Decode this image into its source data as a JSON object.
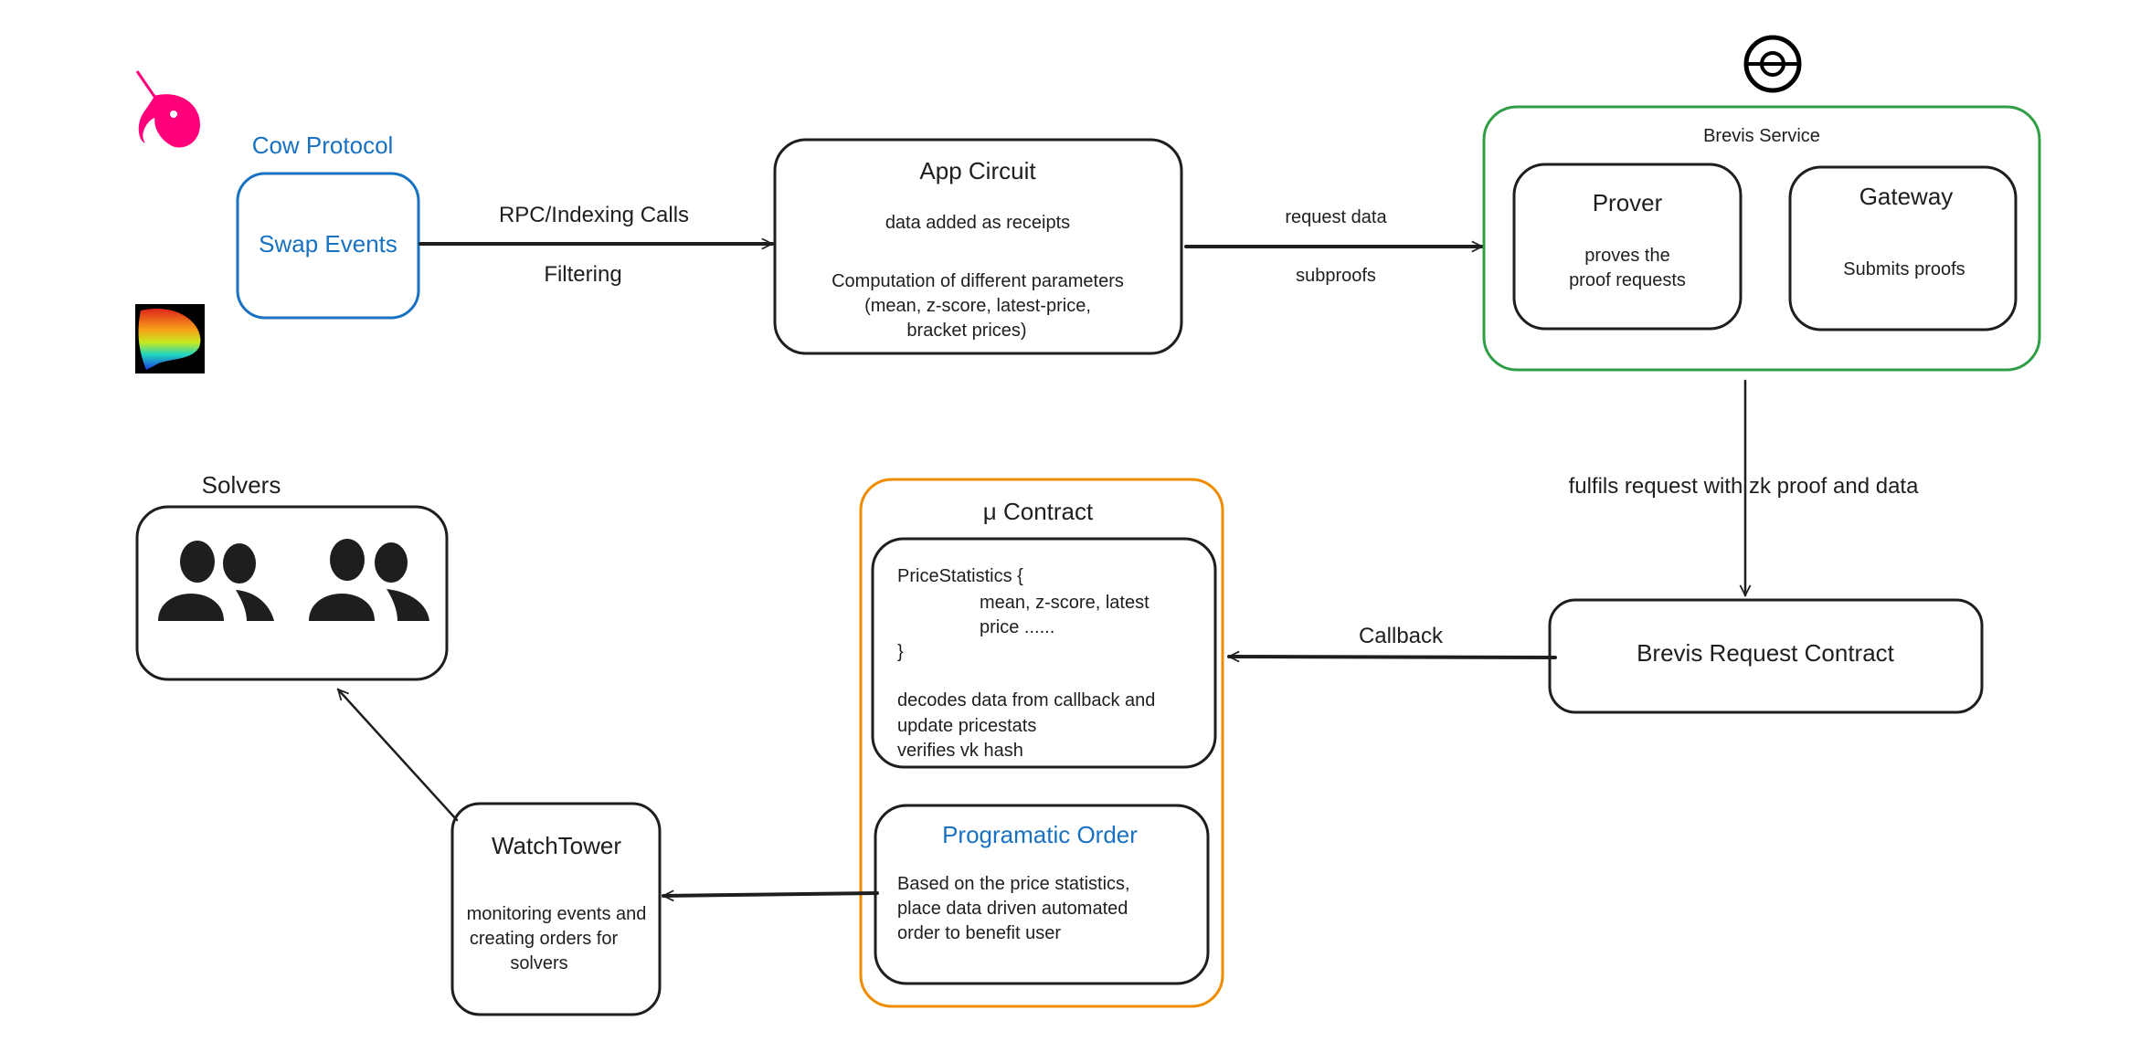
{
  "colors": {
    "ink": "#1e1e1e",
    "blue": "#1971c2",
    "green": "#2f9e44",
    "orange": "#f08c00",
    "uniswap_pink": "#ff007a"
  },
  "logos": {
    "uniswap": "Uniswap unicorn logo",
    "curve": "Curve logo",
    "brevis": "Brevis logo"
  },
  "source": {
    "title": "Cow Protocol",
    "box_label": "Swap Events"
  },
  "edge_source_app": {
    "top": "RPC/Indexing Calls",
    "bottom": "Filtering"
  },
  "app_circuit": {
    "title": "App Circuit",
    "line1": "data added as receipts",
    "line2": "Computation of different parameters",
    "line3": "(mean, z-score, latest-price,",
    "line4": "bracket prices)"
  },
  "edge_app_brevis": {
    "top": "request data",
    "bottom": "subproofs"
  },
  "brevis_service": {
    "title": "Brevis Service",
    "prover": {
      "title": "Prover",
      "line1": "proves the",
      "line2": "proof requests"
    },
    "gateway": {
      "title": "Gateway",
      "line1": "Submits proofs"
    }
  },
  "edge_fulfil": "fulfils request with zk proof and data",
  "brevis_request_contract": "Brevis Request Contract",
  "edge_callback": "Callback",
  "mu_contract": {
    "title": "μ Contract",
    "stats": {
      "line1": "PriceStatistics {",
      "line2": "mean, z-score, latest",
      "line3": "price ......",
      "line4": "}",
      "line5": "decodes data from callback and",
      "line6": "update pricestats",
      "line7": "verifies vk hash"
    },
    "order": {
      "title": "Programatic Order",
      "line1": "Based on the price statistics,",
      "line2": "place data driven automated",
      "line3": " order to benefit user"
    }
  },
  "watchtower": {
    "title": "WatchTower",
    "line1": "monitoring events and",
    "line2": "creating orders for",
    "line3": "solvers"
  },
  "solvers": {
    "title": "Solvers",
    "icon": "users-icon"
  }
}
